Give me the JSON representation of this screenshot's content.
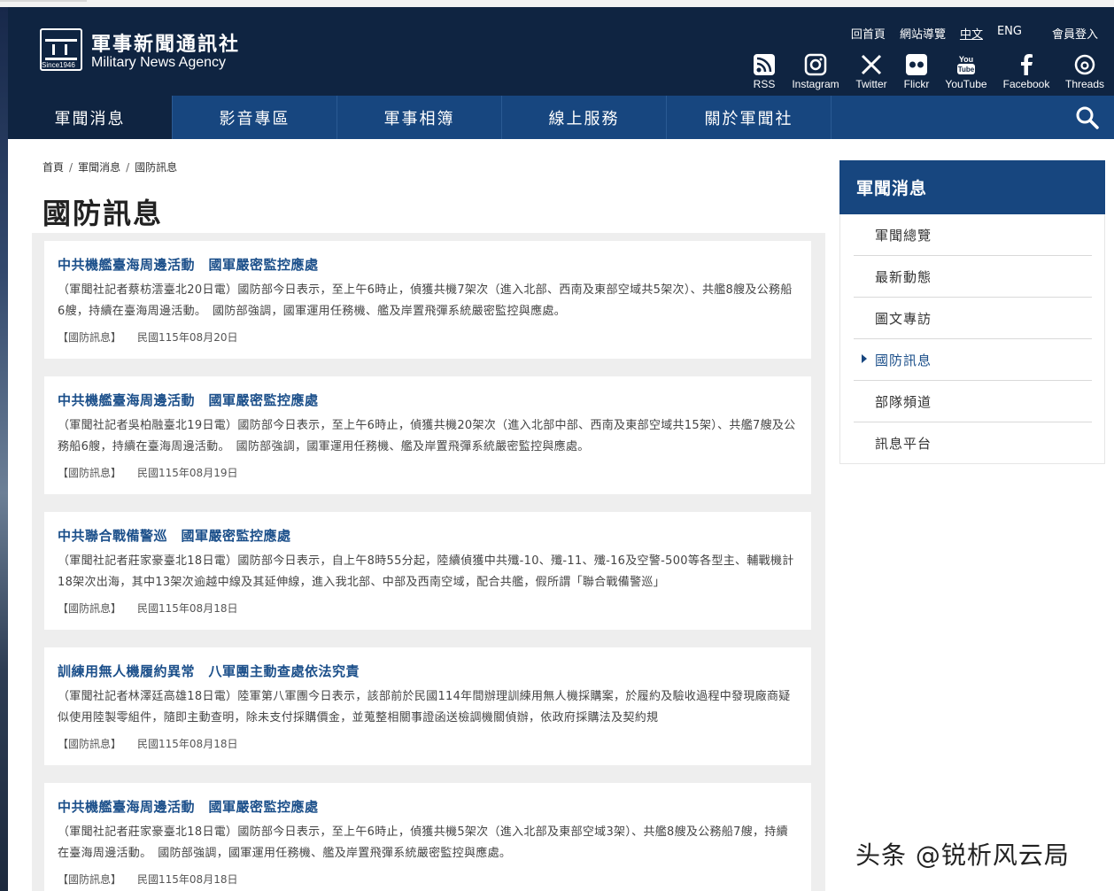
{
  "header": {
    "logo_zh": "軍事新聞通訊社",
    "logo_en": "Military News Agency",
    "logo_since": "Since1946",
    "top_links": [
      "回首頁",
      "網站導覽",
      "中文",
      "ENG"
    ],
    "member_login": "會員登入",
    "social": [
      {
        "label": "RSS",
        "icon": "rss-icon"
      },
      {
        "label": "Instagram",
        "icon": "instagram-icon"
      },
      {
        "label": "Twitter",
        "icon": "x-twitter-icon"
      },
      {
        "label": "Flickr",
        "icon": "flickr-icon"
      },
      {
        "label": "YouTube",
        "icon": "youtube-icon"
      },
      {
        "label": "Facebook",
        "icon": "facebook-icon"
      },
      {
        "label": "Threads",
        "icon": "threads-icon"
      }
    ]
  },
  "nav": {
    "items": [
      "軍聞消息",
      "影音專區",
      "軍事相簿",
      "線上服務",
      "關於軍聞社"
    ],
    "active_index": 0
  },
  "breadcrumb": [
    "首頁",
    "軍聞消息",
    "國防訊息"
  ],
  "page_title": "國防訊息",
  "articles": [
    {
      "title": "中共機艦臺海周邊活動　國軍嚴密監控應處",
      "summary": "（軍聞社記者蔡枋澐臺北20日電）國防部今日表示，至上午6時止，偵獲共機7架次（進入北部、西南及東部空域共5架次）、共艦8艘及公務船6艘，持續在臺海周邊活動。　國防部強調，國軍運用任務機、艦及岸置飛彈系統嚴密監控與應處。",
      "category": "【國防訊息】",
      "date": "民國115年08月20日"
    },
    {
      "title": "中共機艦臺海周邊活動　國軍嚴密監控應處",
      "summary": "（軍聞社記者吳柏融臺北19日電）國防部今日表示，至上午6時止，偵獲共機20架次（進入北部中部、西南及東部空域共15架）、共艦7艘及公務船6艘，持續在臺海周邊活動。　國防部強調，國軍運用任務機、艦及岸置飛彈系統嚴密監控與應處。",
      "category": "【國防訊息】",
      "date": "民國115年08月19日"
    },
    {
      "title": "中共聯合戰備警巡　國軍嚴密監控應處",
      "summary": "（軍聞社記者莊家豪臺北18日電）國防部今日表示，自上午8時55分起，陸續偵獲中共殲-10、殲-11、殲-16及空警-500等各型主、輔戰機計18架次出海，其中13架次逾越中線及其延伸線，進入我北部、中部及西南空域，配合共艦，假所謂「聯合戰備警巡」",
      "category": "【國防訊息】",
      "date": "民國115年08月18日"
    },
    {
      "title": "訓練用無人機履約異常　八軍團主動查處依法究責",
      "summary": "（軍聞社記者林澤廷高雄18日電）陸軍第八軍團今日表示，該部前於民國114年間辦理訓練用無人機採購案，於履約及驗收過程中發現廠商疑似使用陸製零組件，隨即主動查明，除未支付採購價金，並蒐整相關事證函送檢調機關偵辦，依政府採購法及契約規",
      "category": "【國防訊息】",
      "date": "民國115年08月18日"
    },
    {
      "title": "中共機艦臺海周邊活動　國軍嚴密監控應處",
      "summary": "（軍聞社記者莊家豪臺北18日電）國防部今日表示，至上午6時止，偵獲共機5架次（進入北部及東部空域3架）、共艦8艘及公務船7艘，持續在臺海周邊活動。　國防部強調，國軍運用任務機、艦及岸置飛彈系統嚴密監控與應處。",
      "category": "【國防訊息】",
      "date": "民國115年08月18日"
    }
  ],
  "sidebar": {
    "title": "軍聞消息",
    "items": [
      "軍聞總覽",
      "最新動態",
      "圖文專訪",
      "國防訊息",
      "部隊頻道",
      "訊息平台"
    ],
    "active_index": 3
  },
  "watermark": "头条 @锐析风云局",
  "colors": {
    "header_bg": "#0f2441",
    "nav_bg": "#17467f",
    "link_blue": "#1b4f8a"
  }
}
